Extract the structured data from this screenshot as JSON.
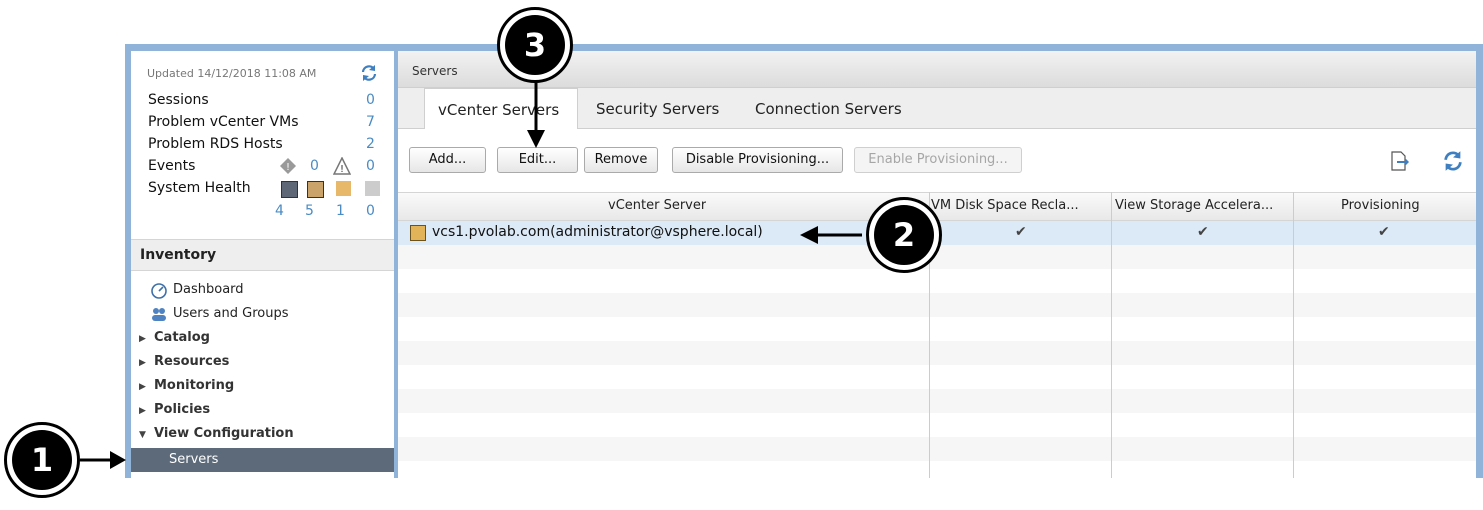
{
  "status": {
    "updated": "Updated 14/12/2018 11:08 AM",
    "items": [
      {
        "label": "Sessions",
        "value": "0"
      },
      {
        "label": "Problem vCenter VMs",
        "value": "7"
      },
      {
        "label": "Problem RDS Hosts",
        "value": "2"
      },
      {
        "label": "Events",
        "value_a": "0",
        "value_b": "0"
      },
      {
        "label": "System Health",
        "counts": [
          "4",
          "5",
          "1",
          "0"
        ]
      }
    ]
  },
  "inventory": {
    "title": "Inventory",
    "items": [
      {
        "label": "Dashboard",
        "icon": "dashboard-icon"
      },
      {
        "label": "Users and Groups",
        "icon": "users-icon"
      },
      {
        "label": "Catalog"
      },
      {
        "label": "Resources"
      },
      {
        "label": "Monitoring"
      },
      {
        "label": "Policies"
      },
      {
        "label": "View Configuration"
      },
      {
        "label": "Servers"
      }
    ]
  },
  "main": {
    "title": "Servers",
    "tabs": [
      "vCenter Servers",
      "Security Servers",
      "Connection Servers"
    ],
    "buttons": [
      "Add...",
      "Edit...",
      "Remove",
      "Disable Provisioning...",
      "Enable Provisioning..."
    ],
    "columns": [
      "vCenter Server",
      "VM Disk Space Recla...",
      "View Storage Accelera...",
      "Provisioning"
    ],
    "rows": [
      {
        "server": "vcs1.pvolab.com(administrator@vsphere.local)",
        "checks": [
          "✔",
          "✔",
          "✔"
        ]
      }
    ]
  },
  "callouts": [
    "1",
    "2",
    "3"
  ],
  "colors": {
    "accent": "#4a8bc4",
    "selected": "#5c6a7a",
    "frame": "#8fb3d9"
  }
}
